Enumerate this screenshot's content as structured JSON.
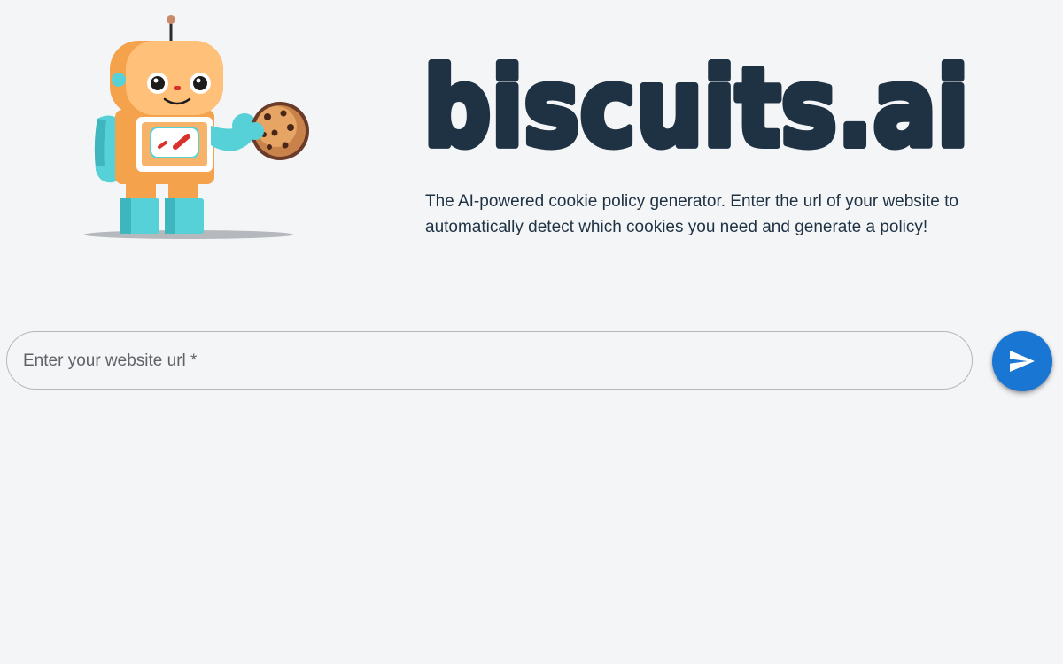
{
  "brand": {
    "logo_text": "biscuits.ai",
    "mascot_icon": "robot-holding-cookie-icon"
  },
  "hero": {
    "tagline": "The AI-powered cookie policy generator. Enter the url of your website to automatically detect which cookies you need and generate a policy!"
  },
  "form": {
    "url_placeholder": "Enter your website url *",
    "url_value": "",
    "submit_icon": "send-icon"
  },
  "colors": {
    "background": "#f4f5f7",
    "text_dark": "#1f3244",
    "accent_button": "#1976d2",
    "robot_orange": "#f4a24c",
    "robot_teal": "#56d1d8"
  }
}
